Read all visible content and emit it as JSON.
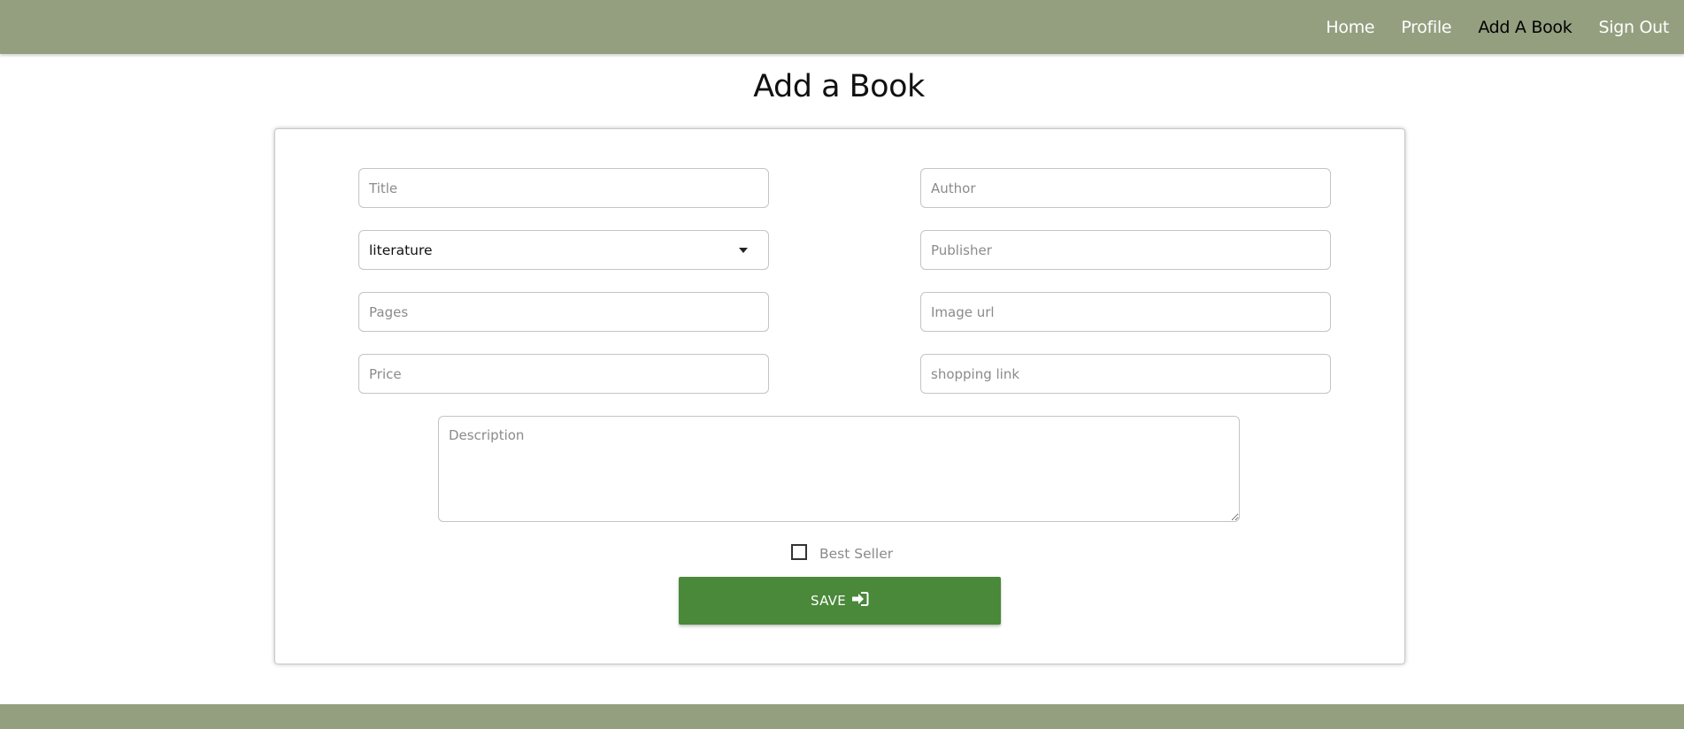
{
  "nav": {
    "items": [
      {
        "label": "Home",
        "active": false
      },
      {
        "label": "Profile",
        "active": false
      },
      {
        "label": "Add A Book",
        "active": true
      },
      {
        "label": "Sign Out",
        "active": false
      }
    ]
  },
  "page": {
    "title": "Add a Book"
  },
  "form": {
    "title_placeholder": "Title",
    "author_placeholder": "Author",
    "category_value": "literature",
    "publisher_placeholder": "Publisher",
    "pages_placeholder": "Pages",
    "image_url_placeholder": "Image url",
    "price_placeholder": "Price",
    "shopping_link_placeholder": "shopping link",
    "description_placeholder": "Description",
    "best_seller_label": "Best Seller",
    "best_seller_checked": false,
    "save_label": "SAVE"
  },
  "colors": {
    "header_bg": "#939f7f",
    "save_button": "#4a883a",
    "active_nav": "#000000",
    "nav_text": "#ffffff"
  },
  "icons": {
    "save": "sign-in-icon",
    "select_caret": "caret-down-icon"
  }
}
